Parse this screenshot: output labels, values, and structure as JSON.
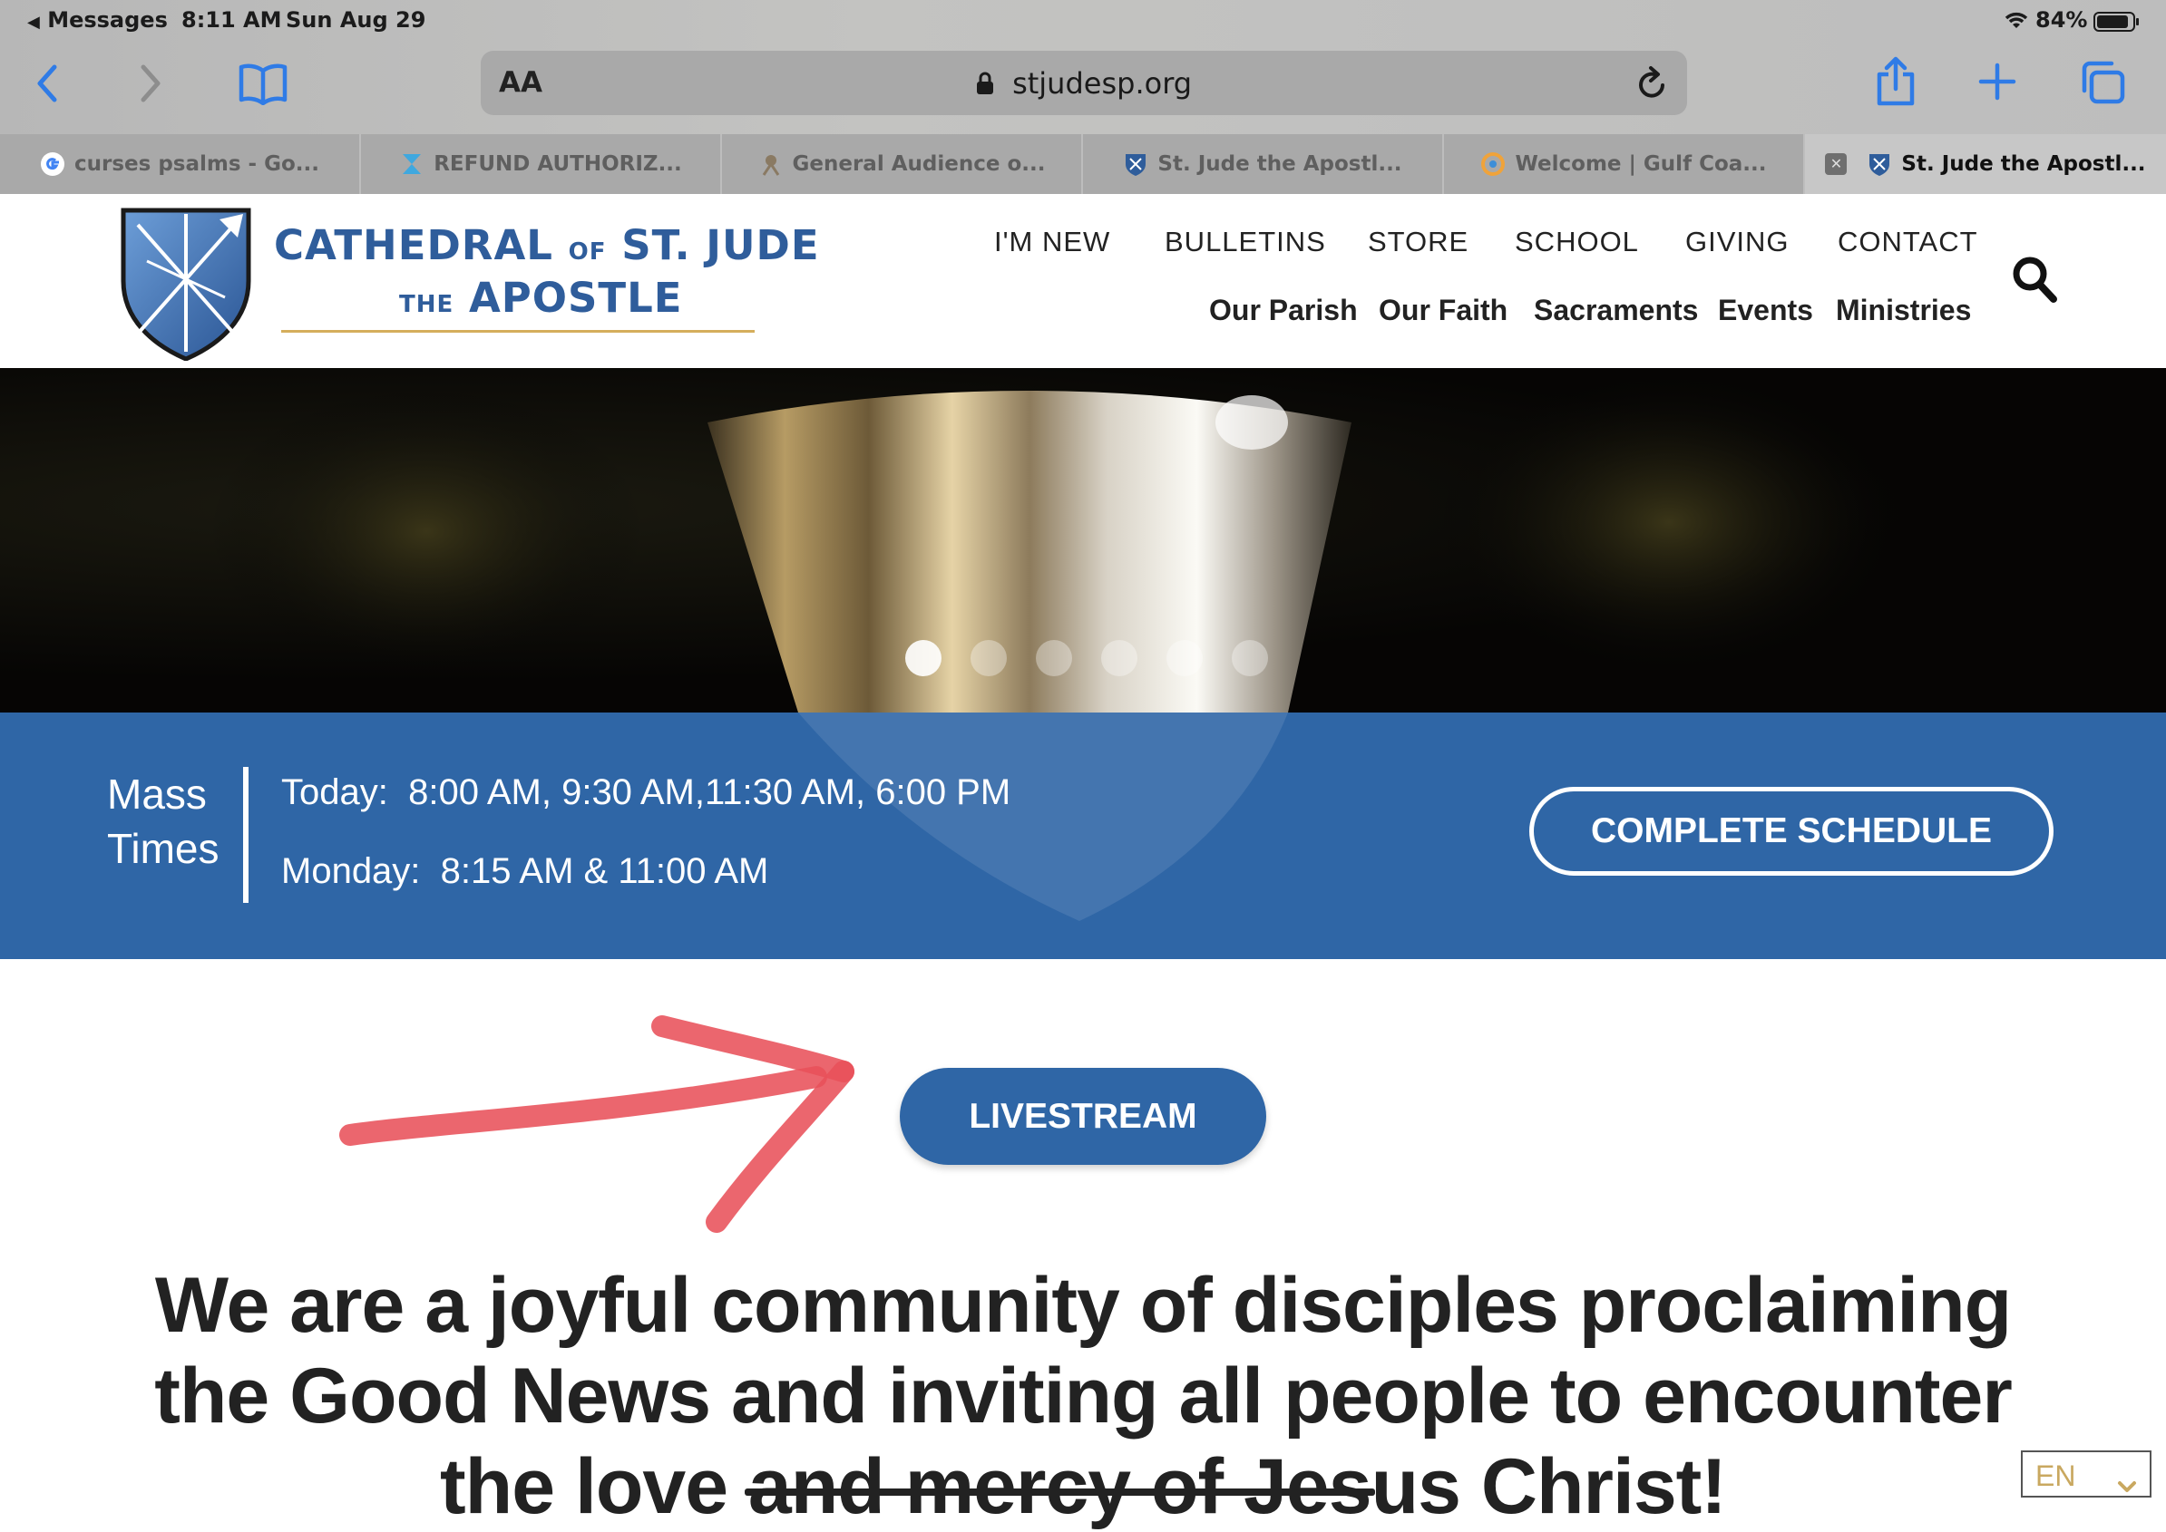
{
  "status_bar": {
    "back_app": "Messages",
    "time": "8:11 AM",
    "date": "Sun Aug 29",
    "battery": "84%"
  },
  "browser": {
    "url_aa": "AA",
    "url": "stjudesp.org",
    "tabs": [
      {
        "label": "curses psalms - Go..."
      },
      {
        "label": "REFUND AUTHORIZ..."
      },
      {
        "label": "General Audience o..."
      },
      {
        "label": "St. Jude the Apostl..."
      },
      {
        "label": "Welcome | Gulf Coa..."
      },
      {
        "label": "St. Jude the Apostl..."
      }
    ],
    "icons": [
      "back-icon",
      "forward-icon",
      "bookmarks-icon",
      "lock-icon",
      "reload-icon",
      "share-icon",
      "new-tab-icon",
      "tabs-overview-icon"
    ]
  },
  "site": {
    "logo_line1_a": "CATHEDRAL",
    "logo_line1_of": "OF",
    "logo_line1_b": "ST. JUDE",
    "logo_line2_the": "THE",
    "logo_line2_b": "APOSTLE",
    "top_nav": [
      "I'M NEW",
      "BULLETINS",
      "STORE",
      "SCHOOL",
      "GIVING",
      "CONTACT"
    ],
    "main_nav": [
      "Our Parish",
      "Our Faith",
      "Sacraments",
      "Events",
      "Ministries"
    ],
    "colors": {
      "brand_blue": "#2f66a6",
      "logo_blue": "#2f5d9b",
      "gold": "#d5ae5c",
      "annotation_red": "#e8515a"
    }
  },
  "hero": {
    "slide_count": 6,
    "active_slide": 1
  },
  "mass_times": {
    "label_line1": "Mass",
    "label_line2": "Times",
    "today_label": "Today:",
    "today_times": "8:00 AM, 9:30 AM,11:30 AM, 6:00 PM",
    "monday_label": "Monday:",
    "monday_times": "8:15 AM & 11:00 AM",
    "button": "COMPLETE SCHEDULE"
  },
  "livestream": {
    "button": "LIVESTREAM"
  },
  "mission": {
    "line1": "We are a joyful community of disciples proclaiming",
    "line2": "the Good News and inviting all people to encounter",
    "line3_a": "the love ",
    "line3_struck": "and mercy of Jes",
    "line3_b": "us Christ!"
  },
  "language": {
    "selected": "EN"
  }
}
